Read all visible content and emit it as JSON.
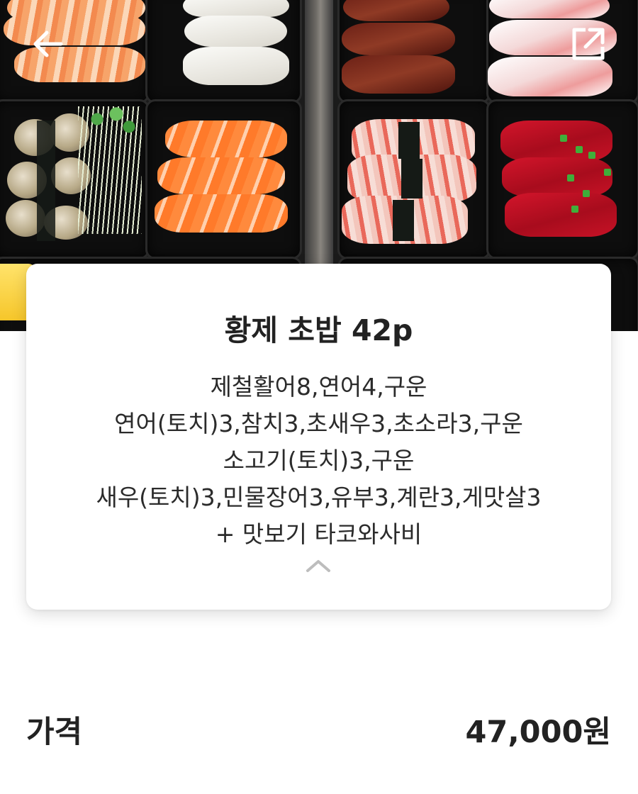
{
  "header": {
    "back_icon": "arrow-left-icon",
    "share_icon": "share-external-icon"
  },
  "hero": {
    "image_subject": "sushi-platter-photo"
  },
  "product": {
    "title": "황제 초밥 42p",
    "description_lines": [
      "제철활어8,연어4,구운",
      "연어(토치)3,참치3,초새우3,초소라3,구운",
      "소고기(토치)3,구운",
      "새우(토치)3,민물장어3,유부3,계란3,게맛살3",
      "+ 맛보기 타코와사비"
    ],
    "collapse_icon": "chevron-up-icon"
  },
  "price": {
    "label": "가격",
    "value": "47,000원"
  },
  "colors": {
    "text": "#222222",
    "card_bg": "#ffffff",
    "icon_white": "#ffffff",
    "chevron_gray": "#bdbdbd"
  }
}
